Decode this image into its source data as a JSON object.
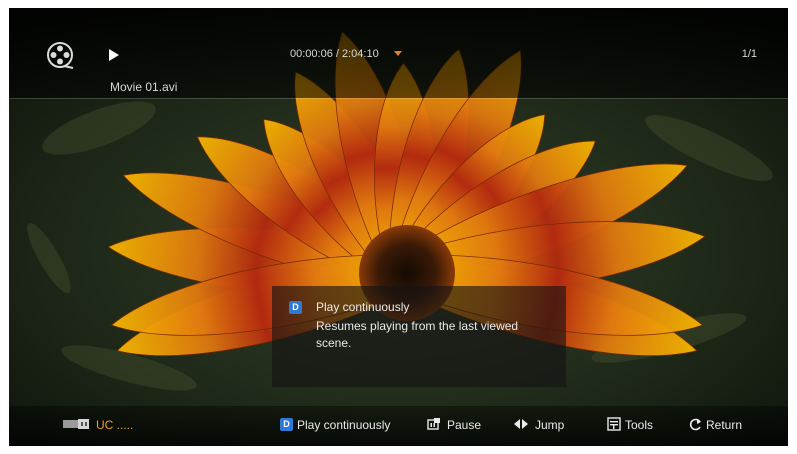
{
  "header": {
    "file_name": "Movie 01.avi",
    "time_display": "00:00:06 / 2:04:10",
    "page_indicator": "1/1"
  },
  "info_popup": {
    "badge": "D",
    "title": "Play continuously",
    "description": "Resumes playing from the last viewed scene."
  },
  "footer": {
    "device_label": "UC .....",
    "actions": [
      {
        "badge": "D",
        "icon": "blue-d-button-icon",
        "label": "Play continuously"
      },
      {
        "icon": "pause-button-icon",
        "label": "Pause"
      },
      {
        "icon": "left-right-arrows-icon",
        "label": "Jump"
      },
      {
        "icon": "tools-icon",
        "label": "Tools"
      },
      {
        "icon": "return-icon",
        "label": "Return"
      }
    ]
  },
  "colors": {
    "accent_orange": "#f07a2a",
    "badge_blue": "#2e78d6",
    "device_label": "#f0a020"
  }
}
